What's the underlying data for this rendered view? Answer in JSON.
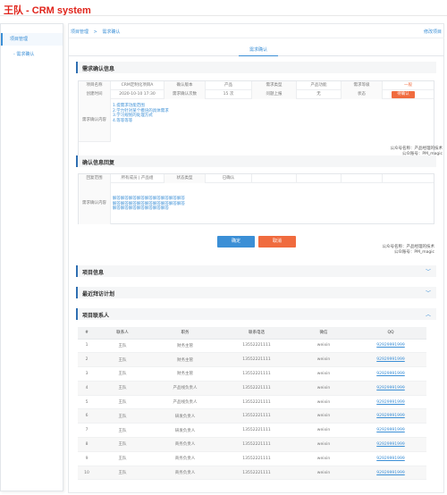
{
  "brand": "王队 - CRM system",
  "sidebar": {
    "items": [
      {
        "label": "项目管理"
      },
      {
        "label": "- 需求确认"
      }
    ]
  },
  "breadcrumb": {
    "items": [
      "项目管理",
      ">",
      "需求确认"
    ]
  },
  "edit_label": "修改项目",
  "tab_label": "需求确认",
  "confirm_section": {
    "title": "需求确认信息",
    "row1": [
      "项目名称",
      "CRM定制化项目A",
      "确认版本",
      "产品",
      "需求类型",
      "产品功能",
      "需求等级",
      "一般"
    ],
    "row2": [
      "创建时间",
      "2020-10-10 17:30",
      "需求确认次数",
      "15 次",
      "问题上报",
      "无",
      "状态"
    ],
    "status": "待确认",
    "content_label": "需求确认内容",
    "content_lines": [
      "1.提需求功能范围",
      "2.学力针对某个模块的具体需求",
      "3.学习规划的处理方式",
      "4.等等等等"
    ],
    "sign": [
      "公众号名称：产品经理的技术",
      "公众账号：PM_magic"
    ]
  },
  "reply_section": {
    "title": "确认信息回复",
    "row1": [
      "回复范围",
      "所有成员 | 产品组",
      "状态类型",
      "已确认"
    ],
    "content_label": "需求确认内容",
    "content_lines": [
      "解答解答解答解答解答解答解答解答解答",
      "解答解答解答解答解答解答解答解答解答",
      "解答解答解答解答解答解答解答"
    ],
    "ok_label": "确定",
    "cancel_label": "取消",
    "sign": [
      "公众号名称：产品经理的技术",
      "公众账号：PM_magic"
    ]
  },
  "project_info_title": "项目信息",
  "plan_title": "最近拜访计划",
  "contacts": {
    "title": "项目联系人",
    "headers": [
      "#",
      "联系人",
      "职务",
      "联系电话",
      "微信",
      "QQ"
    ],
    "rows": [
      [
        "1",
        "王队",
        "财务主管",
        "13552221111",
        "weixin",
        "92929991999"
      ],
      [
        "2",
        "王队",
        "财务主管",
        "13552221111",
        "weixin",
        "92929991999"
      ],
      [
        "3",
        "王队",
        "财务主管",
        "13552221111",
        "weixin",
        "92929991999"
      ],
      [
        "4",
        "王队",
        "产品线负责人",
        "13552221111",
        "weixin",
        "92929991999"
      ],
      [
        "5",
        "王队",
        "产品线负责人",
        "13552221111",
        "weixin",
        "92929991999"
      ],
      [
        "6",
        "王队",
        "研发负责人",
        "13552221111",
        "weixin",
        "92929991999"
      ],
      [
        "7",
        "王队",
        "研发负责人",
        "13552221111",
        "weixin",
        "92929991999"
      ],
      [
        "8",
        "王队",
        "商务负责人",
        "13552221111",
        "weixin",
        "92929991999"
      ],
      [
        "9",
        "王队",
        "商务负责人",
        "13552221111",
        "weixin",
        "92929991999"
      ],
      [
        "10",
        "王队",
        "商务负责人",
        "13552221111",
        "weixin",
        "92929991999"
      ]
    ]
  },
  "colors": {
    "accent": "#3b8fd6",
    "brand": "#e0241b",
    "warning": "#f06b3e"
  }
}
